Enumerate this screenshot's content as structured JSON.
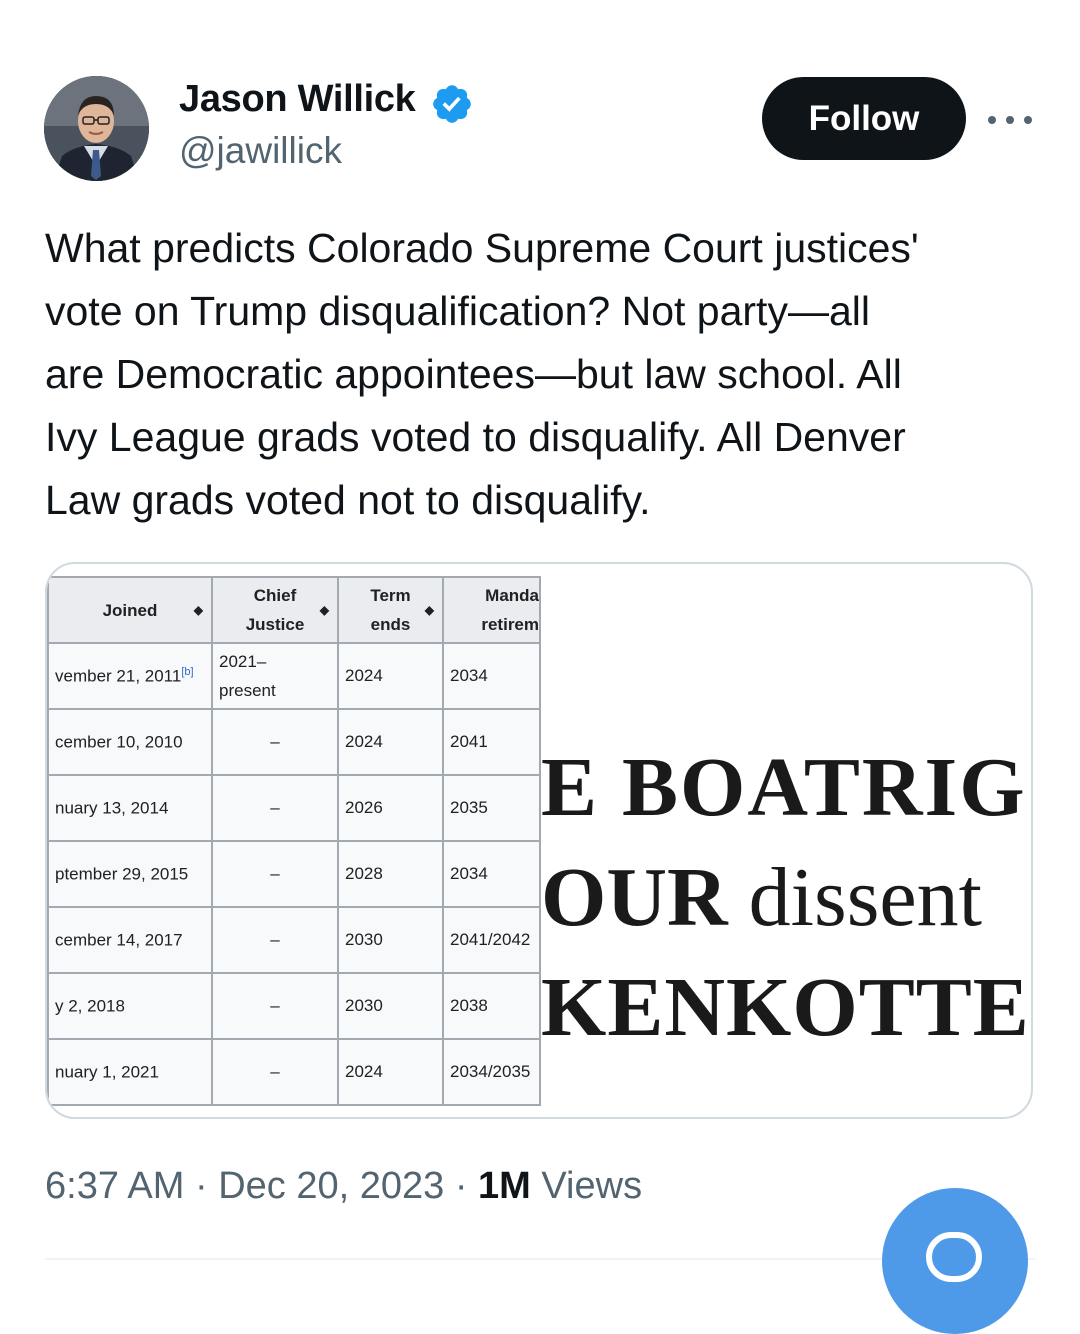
{
  "author": {
    "name": "Jason Willick",
    "handle": "@jawillick",
    "verified": true
  },
  "follow_button": {
    "label": "Follow"
  },
  "more_icon": "more-horizontal-icon",
  "tweet": {
    "text": "What predicts Colorado Supreme Court justices'\nvote on Trump disqualification? Not party—all\nare Democratic appointees—but law school. All\nIvy League grads voted to disqualify. All Denver\nLaw grads voted not to disqualify."
  },
  "media": {
    "table": {
      "headers": [
        "Joined",
        "Chief\nJustice",
        "Term\nends",
        "Manda\nretirem"
      ],
      "rows": [
        {
          "joined": "vember 21, 2011",
          "note": "[b]",
          "chief": "2021–\npresent",
          "term": "2024",
          "retire": "2034"
        },
        {
          "joined": "cember 10, 2010",
          "note": "",
          "chief": "–",
          "term": "2024",
          "retire": "2041"
        },
        {
          "joined": "nuary 13, 2014",
          "note": "",
          "chief": "–",
          "term": "2026",
          "retire": "2035"
        },
        {
          "joined": "ptember 29, 2015",
          "note": "",
          "chief": "–",
          "term": "2028",
          "retire": "2034"
        },
        {
          "joined": "cember 14, 2017",
          "note": "",
          "chief": "–",
          "term": "2030",
          "retire": "2041/2042"
        },
        {
          "joined": "y 2, 2018",
          "note": "",
          "chief": "–",
          "term": "2030",
          "retire": "2038"
        },
        {
          "joined": "nuary 1, 2021",
          "note": "",
          "chief": "–",
          "term": "2024",
          "retire": "2034/2035"
        }
      ]
    },
    "dissent_excerpt": {
      "line1": "E BOATRIG",
      "line2_bold": "OUR",
      "line2_rest": " dissent",
      "line3": "ΚENKOTTER"
    }
  },
  "meta": {
    "time": "6:37 AM",
    "sep1": " · ",
    "date": "Dec 20, 2023",
    "sep2": " · ",
    "views_count": "1M",
    "views_label": " Views"
  },
  "fab_icon": "compose-reply-icon",
  "colors": {
    "verified_blue": "#1d9bf0",
    "follow_bg": "#0f1419",
    "fab_blue": "#4f9ae8",
    "secondary_text": "#536471"
  }
}
